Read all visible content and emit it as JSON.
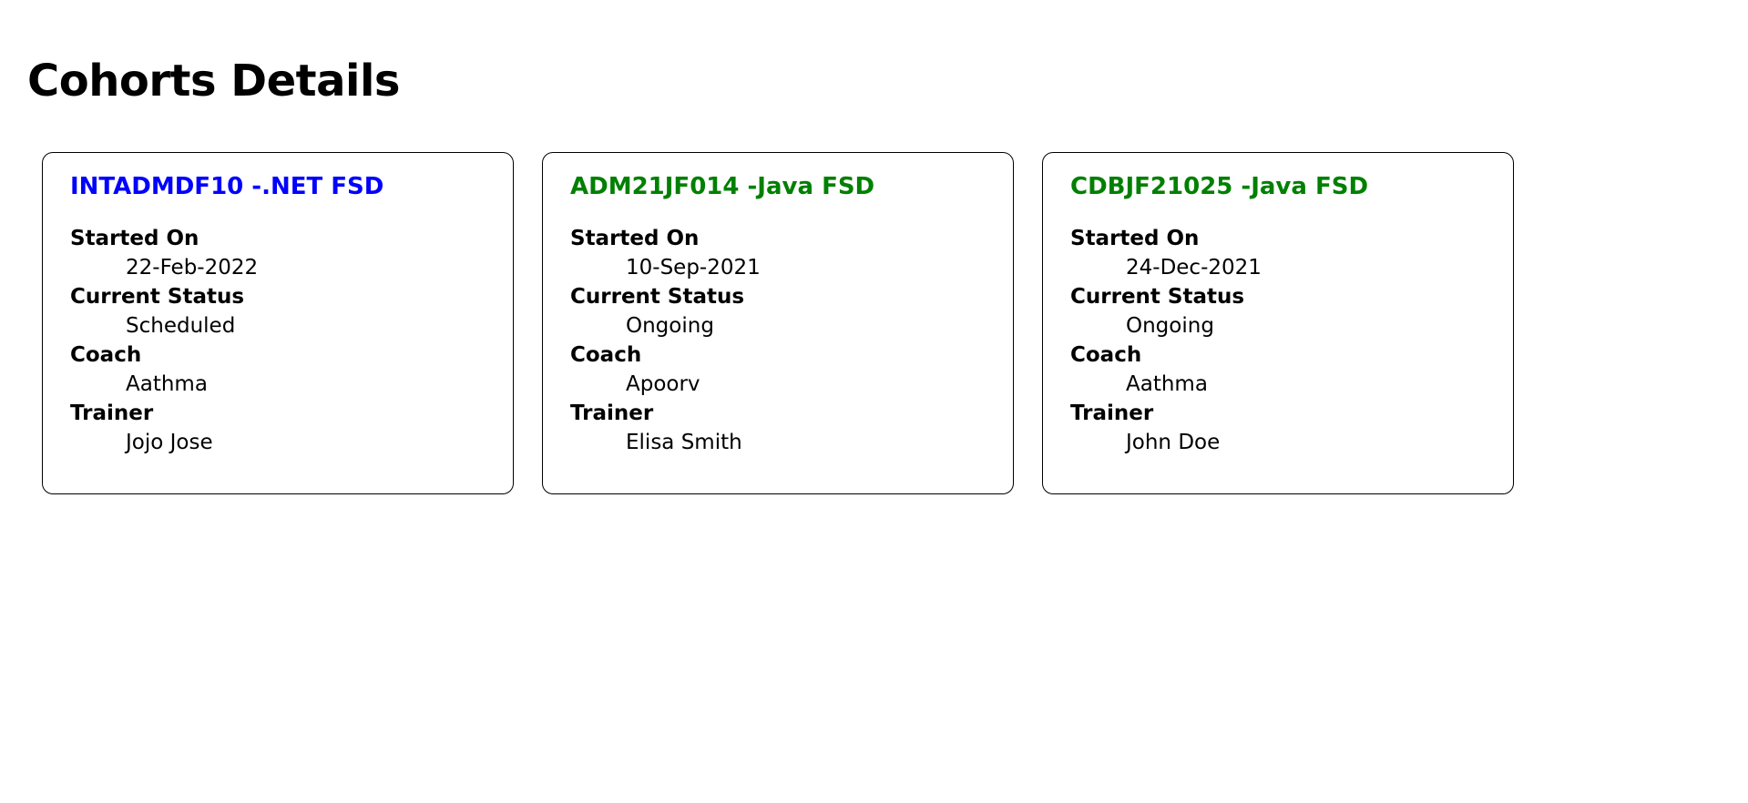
{
  "page": {
    "title": "Cohorts Details"
  },
  "colors": {
    "scheduled_title": "#0000ff",
    "ongoing_title": "#008000"
  },
  "cohorts": [
    {
      "title": "INTADMDF10 -.NET FSD",
      "started_on_label": "Started On",
      "started_on": "22-Feb-2022",
      "status_label": "Current Status",
      "status": "Scheduled",
      "coach_label": "Coach",
      "coach": "Aathma",
      "trainer_label": "Trainer",
      "trainer": "Jojo Jose"
    },
    {
      "title": "ADM21JF014 -Java FSD",
      "started_on_label": "Started On",
      "started_on": "10-Sep-2021",
      "status_label": "Current Status",
      "status": "Ongoing",
      "coach_label": "Coach",
      "coach": "Apoorv",
      "trainer_label": "Trainer",
      "trainer": "Elisa Smith"
    },
    {
      "title": "CDBJF21025 -Java FSD",
      "started_on_label": "Started On",
      "started_on": "24-Dec-2021",
      "status_label": "Current Status",
      "status": "Ongoing",
      "coach_label": "Coach",
      "coach": "Aathma",
      "trainer_label": "Trainer",
      "trainer": "John Doe"
    }
  ]
}
